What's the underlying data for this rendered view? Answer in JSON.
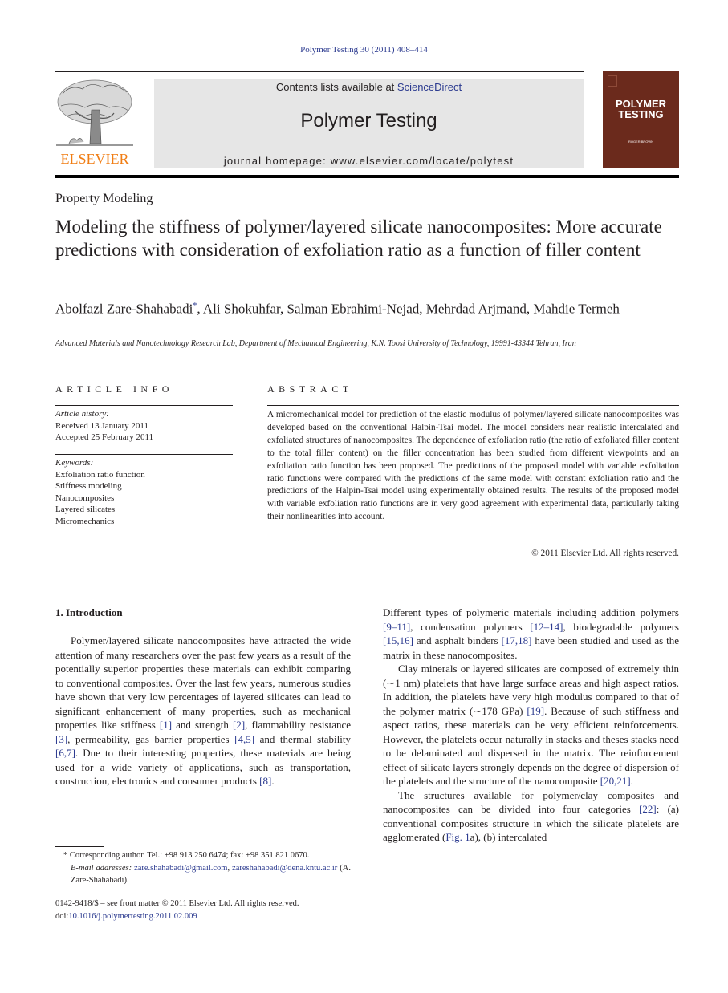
{
  "citation": "Polymer Testing 30 (2011) 408–414",
  "header": {
    "publisher_logo_text": "ELSEVIER",
    "contents_prefix": "Contents lists available at ",
    "contents_link": "ScienceDirect",
    "journal_name": "Polymer Testing",
    "homepage": "journal homepage: www.elsevier.com/locate/polytest",
    "cover_title_line1": "POLYMER",
    "cover_title_line2": "TESTING",
    "cover_editor": "ROGER BROWN",
    "colors": {
      "link": "#2b3a8f",
      "elsevier_orange": "#f07d14",
      "cover_brown": "#6b2a1c",
      "banner_gray": "#e6e6e6"
    }
  },
  "article": {
    "section": "Property Modeling",
    "title": "Modeling the stiffness of polymer/layered silicate nanocomposites: More accurate predictions with consideration of exfoliation ratio as a function of filler content",
    "authors_first": "Abolfazl Zare-Shahabadi",
    "authors_mark": "*",
    "authors_rest": ", Ali Shokuhfar, Salman Ebrahimi-Nejad, Mehrdad Arjmand, Mahdie Termeh",
    "affiliation": "Advanced Materials and Nanotechnology Research Lab, Department of Mechanical Engineering, K.N. Toosi University of Technology, 19991-43344 Tehran, Iran"
  },
  "article_info": {
    "heading": "ARTICLE INFO",
    "history_label": "Article history:",
    "received": "Received 13 January 2011",
    "accepted": "Accepted 25 February 2011",
    "keywords_label": "Keywords:",
    "keywords": [
      "Exfoliation ratio function",
      "Stiffness modeling",
      "Nanocomposites",
      "Layered silicates",
      "Micromechanics"
    ]
  },
  "abstract": {
    "heading": "ABSTRACT",
    "text": "A micromechanical model for prediction of the elastic modulus of polymer/layered silicate nanocomposites was developed based on the conventional Halpin-Tsai model. The model considers near realistic intercalated and exfoliated structures of nanocomposites. The dependence of exfoliation ratio (the ratio of exfoliated filler content to the total filler content) on the filler concentration has been studied from different viewpoints and an exfoliation ratio function has been proposed. The predictions of the proposed model with variable exfoliation ratio functions were compared with the predictions of the same model with constant exfoliation ratio and the predictions of the Halpin-Tsai model using experimentally obtained results. The results of the proposed model with variable exfoliation ratio functions are in very good agreement with experimental data, particularly taking their nonlinearities into account.",
    "copyright": "© 2011 Elsevier Ltd. All rights reserved."
  },
  "introduction": {
    "heading": "1.  Introduction",
    "p1": [
      {
        "t": "Polymer/layered silicate nanocomposites have attracted the wide attention of many researchers over the past few years as a result of the potentially superior properties these materials can exhibit comparing to conventional composites. Over the last few years, numerous studies have shown that very low percentages of layered silicates can lead to significant enhancement of many properties, such as mechanical properties like stiffness "
      },
      {
        "ref": "[1]"
      },
      {
        "t": " and strength "
      },
      {
        "ref": "[2]"
      },
      {
        "t": ", flammability resistance "
      },
      {
        "ref": "[3]"
      },
      {
        "t": ", permeability, gas barrier properties "
      },
      {
        "ref": "[4,5]"
      },
      {
        "t": " and thermal stability "
      },
      {
        "ref": "[6,7]"
      },
      {
        "t": ". Due to their interesting properties, these materials are being used for a wide variety of applications, such as transportation, construction, electronics and consumer products "
      },
      {
        "ref": "[8]"
      },
      {
        "t": "."
      }
    ],
    "p2": [
      {
        "t": "Different types of polymeric materials including addition polymers "
      },
      {
        "ref": "[9–11]"
      },
      {
        "t": ", condensation polymers "
      },
      {
        "ref": "[12–14]"
      },
      {
        "t": ", biodegradable polymers "
      },
      {
        "ref": "[15,16]"
      },
      {
        "t": " and asphalt binders "
      },
      {
        "ref": "[17,18]"
      },
      {
        "t": " have been studied and used as the matrix in these nanocomposites."
      }
    ],
    "p3": [
      {
        "t": "Clay minerals or layered silicates are composed of extremely thin (∼1 nm) platelets that have large surface areas and high aspect ratios. In addition, the platelets have very high modulus compared to that of the polymer matrix (∼178 GPa) "
      },
      {
        "ref": "[19]"
      },
      {
        "t": ". Because of such stiffness and aspect ratios, these materials can be very efficient reinforcements. However, the platelets occur naturally in stacks and theses stacks need to be delaminated and dispersed in the matrix. The reinforcement effect of silicate layers strongly depends on the degree of dispersion of the platelets and the structure of the nanocomposite "
      },
      {
        "ref": "[20,21]"
      },
      {
        "t": "."
      }
    ],
    "p4": [
      {
        "t": "The structures available for polymer/clay composites and nanocomposites can be divided into four categories "
      },
      {
        "ref": "[22]"
      },
      {
        "t": ": (a) conventional composites structure in which the silicate platelets are agglomerated ("
      },
      {
        "ref": "Fig. 1"
      },
      {
        "t": "a), (b) intercalated"
      }
    ]
  },
  "footnote": {
    "mark": "*",
    "corresponding": " Corresponding author. Tel.: +98 913 250 6474; fax: +98 351 821 0670.",
    "email_label": "E-mail addresses:",
    "email1": "zare.shahabadi@gmail.com",
    "email2": "zareshahabadi@dena.kntu.ac.ir",
    "email_owner": " (A. Zare-Shahabadi)."
  },
  "frontmatter": {
    "issn_line": "0142-9418/$ – see front matter © 2011 Elsevier Ltd. All rights reserved.",
    "doi_label": "doi:",
    "doi": "10.1016/j.polymertesting.2011.02.009"
  }
}
